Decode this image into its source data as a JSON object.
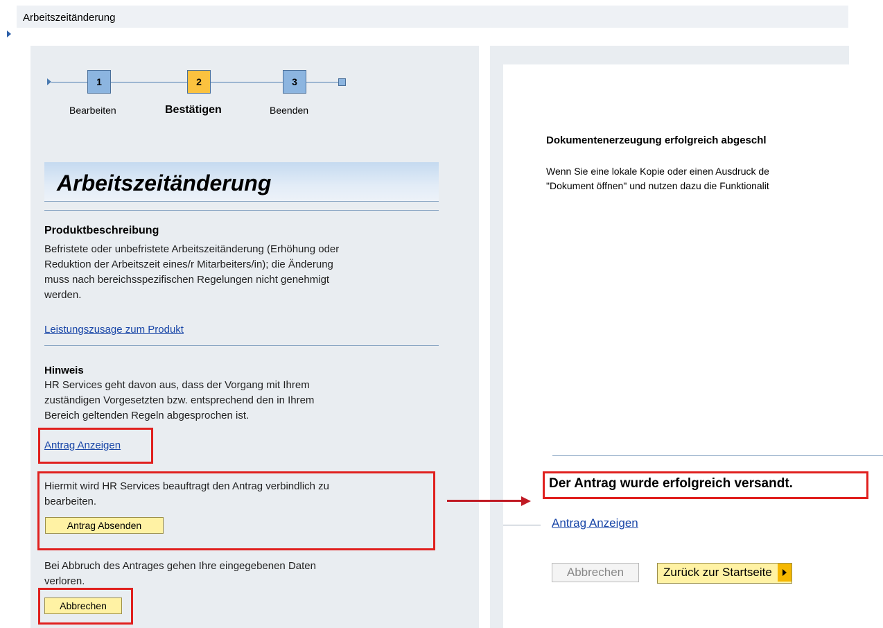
{
  "window": {
    "title": "Arbeitszeitänderung"
  },
  "steps": [
    {
      "number": "1",
      "label": "Bearbeiten"
    },
    {
      "number": "2",
      "label": "Bestätigen"
    },
    {
      "number": "3",
      "label": "Beenden"
    }
  ],
  "left": {
    "banner_title": "Arbeitszeitänderung",
    "product_heading": "Produktbeschreibung",
    "product_lines": [
      "Befristete oder unbefristete Arbeitszeitänderung (Erhöhung oder",
      "Reduktion der Arbeitszeit eines/r Mitarbeiters/in); die Änderung",
      "muss nach bereichsspezifischen Regelungen nicht genehmigt",
      "werden."
    ],
    "product_link": "Leistungszusage zum Produkt",
    "note_heading": "Hinweis",
    "note_lines": [
      "HR Services geht davon aus, dass der Vorgang mit Ihrem",
      "zuständigen Vorgesetzten bzw. entsprechend den in Ihrem",
      "Bereich geltenden Regeln abgesprochen ist."
    ],
    "show_request_link": "Antrag Anzeigen",
    "submit_lines": [
      "Hiermit wird HR Services beauftragt den Antrag verbindlich zu",
      "bearbeiten."
    ],
    "submit_button": "Antrag Absenden",
    "cancel_lines": [
      "Bei Abbruch des Antrages gehen Ihre eingegebenen Daten",
      "verloren."
    ],
    "cancel_button": "Abbrechen"
  },
  "right": {
    "doc_heading": "Dokumentenerzeugung erfolgreich abgeschl",
    "doc_lines": [
      "Wenn Sie eine lokale Kopie oder einen Ausdruck de",
      "\"Dokument öffnen\" und nutzen dazu die Funktionalit"
    ],
    "success_message": "Der Antrag wurde erfolgreich versandt.",
    "show_request_link": "Antrag Anzeigen",
    "cancel_button": "Abbrechen",
    "back_button": "Zurück zur Startseite"
  },
  "colors": {
    "step_active": "#fbc23f",
    "step_inactive": "#8cb5e0",
    "highlight_red": "#e0201e",
    "button_yellow": "#fff2a4",
    "link_blue": "#1a47a8"
  }
}
